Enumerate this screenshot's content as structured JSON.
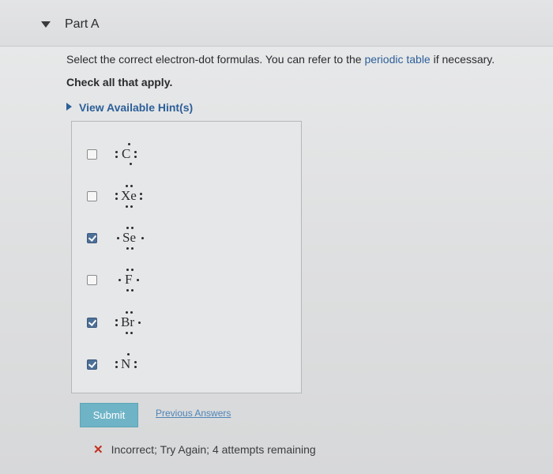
{
  "part": {
    "title": "Part A"
  },
  "question": {
    "instruction_prefix": "Select the correct electron-dot formulas. You can refer to the ",
    "periodic_link": "periodic table",
    "instruction_suffix": " if necessary.",
    "check_all": "Check all that apply."
  },
  "hint": {
    "label": "View Available Hint(s)"
  },
  "options": [
    {
      "symbol": "C",
      "checked": false
    },
    {
      "symbol": "Xe",
      "checked": false
    },
    {
      "symbol": "Se",
      "checked": true
    },
    {
      "symbol": "F",
      "checked": false
    },
    {
      "symbol": "Br",
      "checked": true
    },
    {
      "symbol": "N",
      "checked": true
    }
  ],
  "actions": {
    "submit_label": "Submit",
    "previous_answers_label": "Previous Answers"
  },
  "feedback": {
    "status": "Incorrect; Try Again; 4 attempts remaining"
  },
  "colors": {
    "link": "#2d5f99",
    "submit": "#6fb4c6",
    "error": "#c2301f"
  },
  "icons": {
    "collapse": "caret-down-icon",
    "hint": "caret-right-icon",
    "feedback": "x-icon"
  }
}
